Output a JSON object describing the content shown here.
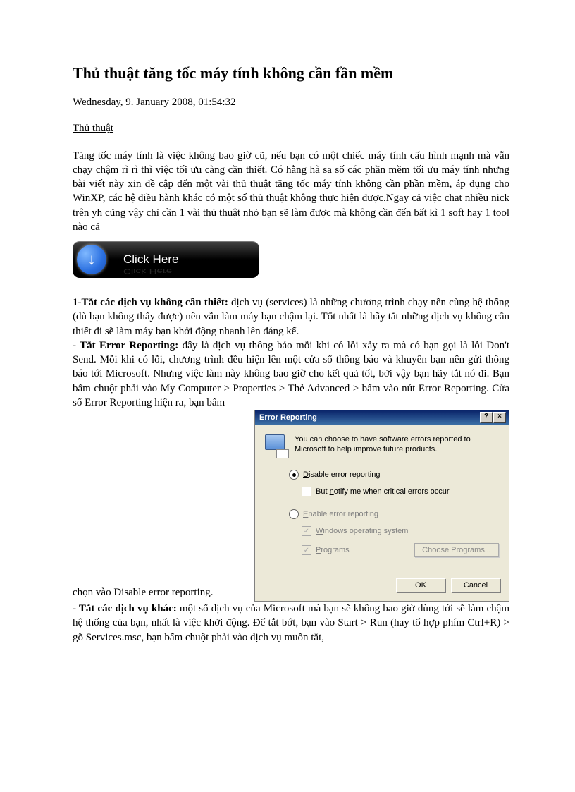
{
  "title": "Thủ thuật tăng tốc máy tính không cần fần mềm",
  "date": "Wednesday, 9. January 2008, 01:54:32",
  "category": "Thủ thuật",
  "intro": "Tăng tốc máy tính là việc không bao giờ cũ, nếu bạn có một chiếc máy tính cấu hình mạnh mà vẫn chạy chậm rì rì thì việc tối ưu càng cần thiết. Có hằng hà sa số các phần mềm tối ưu máy tính nhưng bài viết này xin đề cập đến một vài thủ thuật tăng tốc máy tính không cần phần mềm, áp dụng cho WinXP, các hệ điều hành khác có một số thủ thuật không thực hiện được.Ngay cả việc chat nhiều nick trên yh cũng vậy chỉ cần 1 vài thủ thuật nhỏ bạn sẽ làm được mà không cần đến bất kì 1 soft hay 1 tool nào cả",
  "click_here": "Click Here",
  "section1_head": "1-Tắt các dịch vụ không cần thiết:",
  "section1_body": " dịch vụ (services) là những chương trình chạy nền cùng hệ thống (dù bạn không thấy được) nên vẫn làm máy bạn chậm lại. Tốt nhất là hãy tắt những dịch vụ không cần thiết đi sẽ làm máy bạn khởi động nhanh lên đáng kể.",
  "section2_head": "- Tắt Error Reporting:",
  "section2_body": " đây là dịch vụ thông báo mỗi khi có lỗi xảy ra mà có bạn gọi là lỗi Don't Send. Mỗi khi có lỗi, chương trình đều hiện lên một cửa sổ thông báo và khuyên bạn nên gửi thông báo tới Microsoft. Nhưng việc làm này không bao giờ cho kết quả tốt, bởi vậy bạn hãy tắt nó đi. Bạn bấm chuột phải vào My Computer > Properties > Thẻ Advanced > bấm vào nút Error Reporting. Cửa sổ Error Reporting hiện ra, bạn bấm",
  "dialog_prefix": "chọn vào Disable error reporting.",
  "section3_head": "- Tắt các dịch vụ khác:",
  "section3_body": " một số dịch vụ của Microsoft mà bạn sẽ không bao giờ dùng tới sẽ làm chậm hệ thống của bạn, nhất là việc khởi động. Để tắt bớt, bạn vào Start > Run (hay tổ hợp phím Ctrl+R) > gõ Services.msc, bạn bấm chuột phải vào dịch vụ muốn tắt,",
  "dialog": {
    "title": "Error Reporting",
    "help_btn": "?",
    "close_btn": "×",
    "description": "You can choose to have software errors reported to Microsoft to help improve future products.",
    "disable_label_pre": "D",
    "disable_label_post": "isable error reporting",
    "notify_pre": "But ",
    "notify_und": "n",
    "notify_post": "otify me when critical errors occur",
    "enable_pre": "E",
    "enable_post": "nable error reporting",
    "win_pre": "W",
    "win_post": "indows operating system",
    "prog_pre": "P",
    "prog_post": "rograms",
    "choose_programs": "Choose Programs...",
    "ok": "OK",
    "cancel": "Cancel"
  }
}
